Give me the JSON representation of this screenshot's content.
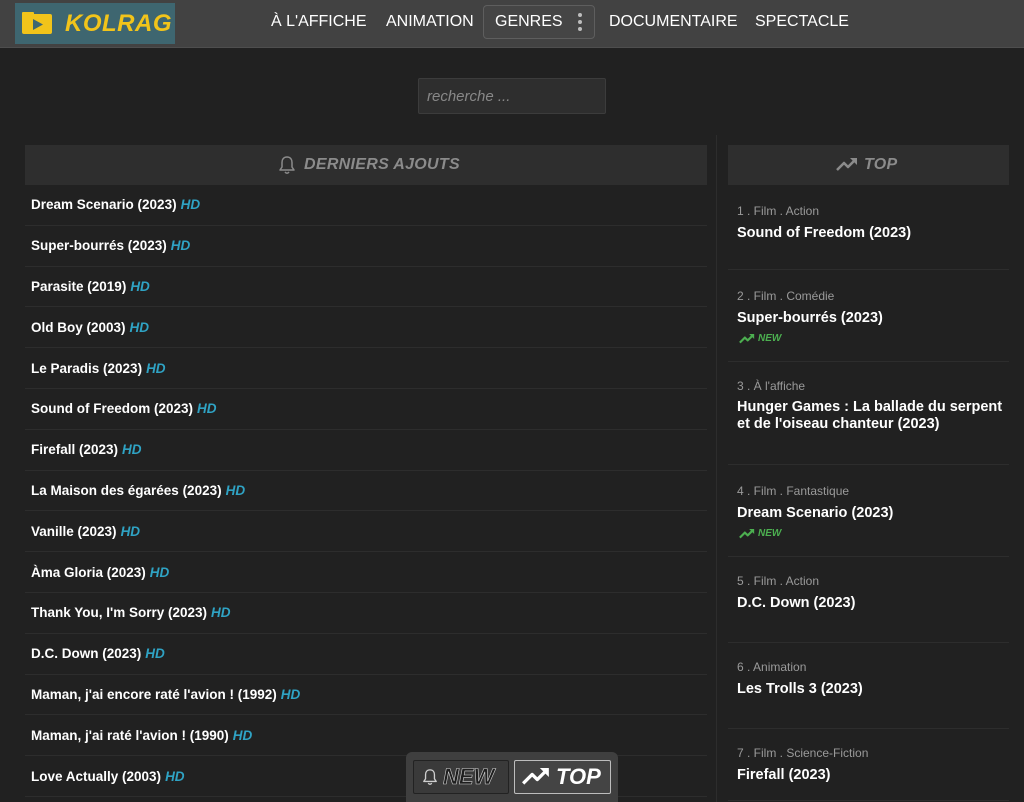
{
  "header": {
    "brand": "KOLRAG",
    "nav": [
      {
        "label": "À L'AFFICHE"
      },
      {
        "label": "ANIMATION"
      },
      {
        "label": "GENRES"
      },
      {
        "label": "DOCUMENTAIRE"
      },
      {
        "label": "SPECTACLE"
      }
    ]
  },
  "search": {
    "placeholder": "recherche ..."
  },
  "latest": {
    "title": "DERNIERS AJOUTS",
    "badge": "HD",
    "items": [
      {
        "title": "Dream Scenario (2023)"
      },
      {
        "title": "Super-bourrés (2023)"
      },
      {
        "title": "Parasite (2019)"
      },
      {
        "title": "Old Boy (2003)"
      },
      {
        "title": "Le Paradis (2023)"
      },
      {
        "title": "Sound of Freedom (2023)"
      },
      {
        "title": "Firefall (2023)"
      },
      {
        "title": "La Maison des égarées (2023)"
      },
      {
        "title": "Vanille (2023)"
      },
      {
        "title": "Àma Gloria (2023)"
      },
      {
        "title": "Thank You, I'm Sorry (2023)"
      },
      {
        "title": "D.C. Down (2023)"
      },
      {
        "title": "Maman, j'ai encore raté l'avion ! (1992)"
      },
      {
        "title": "Maman, j'ai raté l'avion ! (1990)"
      },
      {
        "title": "Love Actually (2003)"
      }
    ]
  },
  "top": {
    "title": "TOP",
    "new_label": "NEW",
    "items": [
      {
        "meta": "1 . Film . Action",
        "title": "Sound of Freedom (2023)",
        "is_new": false
      },
      {
        "meta": "2 . Film . Comédie",
        "title": "Super-bourrés (2023)",
        "is_new": true
      },
      {
        "meta": "3 . À l'affiche",
        "title": "Hunger Games : La ballade du serpent et de l'oiseau chanteur (2023)",
        "is_new": false
      },
      {
        "meta": "4 . Film . Fantastique",
        "title": "Dream Scenario (2023)",
        "is_new": true
      },
      {
        "meta": "5 . Film . Action",
        "title": "D.C. Down (2023)",
        "is_new": false
      },
      {
        "meta": "6 . Animation",
        "title": "Les Trolls 3 (2023)",
        "is_new": false
      },
      {
        "meta": "7 . Film . Science-Fiction",
        "title": "Firefall (2023)",
        "is_new": false
      }
    ]
  },
  "floatbar": {
    "new_label": "NEW",
    "top_label": "TOP"
  },
  "colors": {
    "brand": "#f2c41a",
    "hd": "#2fa3c4",
    "new": "#4caf50",
    "logo_bg": "#3e6670"
  },
  "icons": {
    "brand": "play-folder-icon",
    "latest": "bell-icon",
    "top": "trending-up-icon",
    "genres_menu": "more-vertical-icon"
  }
}
